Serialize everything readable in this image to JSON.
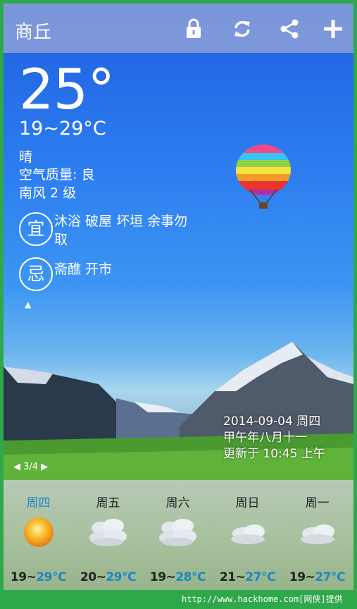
{
  "city": "商丘",
  "current": {
    "temp": "25°",
    "range": "19~29°C",
    "condition": "晴",
    "air_quality": "空气质量: 良",
    "wind": "南风 2 级"
  },
  "almanac": {
    "yi_label": "宜",
    "yi_text": "沐浴 破屋 坏垣 余事勿取",
    "ji_label": "忌",
    "ji_text": "斋醮 开市"
  },
  "expand_arrow": "▲",
  "date_block": {
    "date": "2014-09-04 周四",
    "lunar": "甲午年八月十一",
    "updated": "更新于 10:45 上午"
  },
  "pager": "◀ 3/4 ▶",
  "forecast": [
    {
      "day": "周四",
      "low": "19~",
      "high": "29℃",
      "icon": "sunny-icon"
    },
    {
      "day": "周五",
      "low": "20~",
      "high": "29℃",
      "icon": "cloudy-icon"
    },
    {
      "day": "周六",
      "low": "19~",
      "high": "28℃",
      "icon": "cloudy-icon"
    },
    {
      "day": "周日",
      "low": "21~",
      "high": "27℃",
      "icon": "cloudy-icon"
    },
    {
      "day": "周一",
      "low": "19~",
      "high": "27℃",
      "icon": "cloudy-icon"
    }
  ],
  "toolbar_icons": [
    "lock-icon",
    "refresh-icon",
    "share-icon",
    "add-icon"
  ],
  "colors": {
    "accent": "#1d86c8",
    "frame": "#2ea84a"
  },
  "watermark": "http://www.hackhome.com[网侠]提供"
}
